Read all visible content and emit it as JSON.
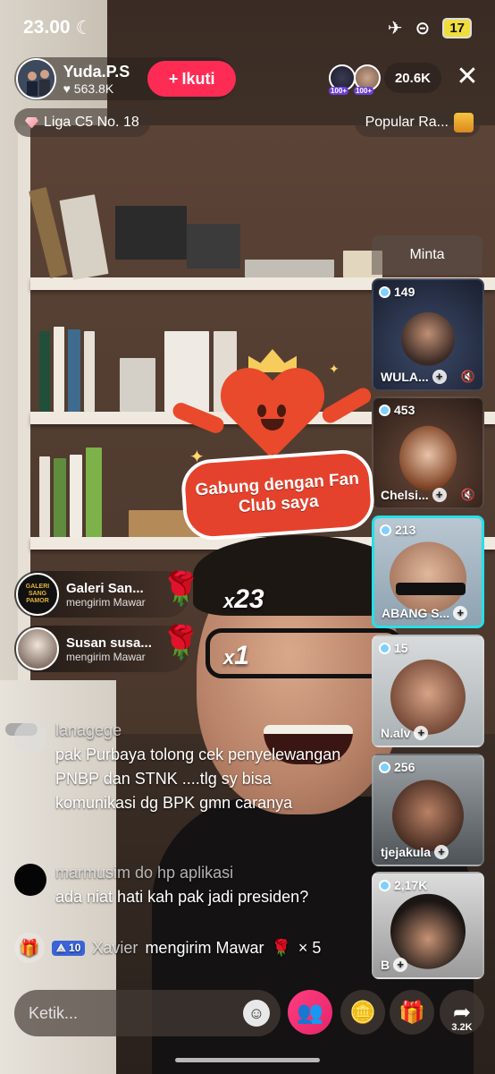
{
  "status_bar": {
    "time": "23.00",
    "battery": "17"
  },
  "host": {
    "name": "Yuda.P.S",
    "likes": "563.8K",
    "follow_label": "Ikuti"
  },
  "viewers": {
    "badge_1": "100+",
    "badge_2": "100+",
    "count": "20.6K"
  },
  "league_label": "Liga C5 No. 18",
  "popular_label": "Popular Ra...",
  "request_label": "Minta",
  "guests": [
    {
      "coins": "149",
      "name": "WULA..."
    },
    {
      "coins": "453",
      "name": "Chelsi..."
    },
    {
      "coins": "213",
      "name": "ABANG S..."
    },
    {
      "coins": "15",
      "name": "N.alv"
    },
    {
      "coins": "256",
      "name": "tjejakula"
    },
    {
      "coins": "2,17K",
      "name": "B"
    }
  ],
  "fanclub": {
    "text": "Gabung dengan Fan Club saya"
  },
  "gifts": [
    {
      "sender": "Galeri San...",
      "action": "mengirim Mawar",
      "count": "23",
      "avatar_text": "GALERI SANG PAMOR"
    },
    {
      "sender": "Susan susa...",
      "action": "mengirim Mawar",
      "count": "1"
    }
  ],
  "comments": [
    {
      "user": "lanagege",
      "text": "pak Purbaya tolong cek penyelewangan PNBP dan STNK ....tlg sy bisa komunikasi dg BPK gmn caranya"
    },
    {
      "user": "marmusim do hp aplikasi",
      "text": "ada niat hati kah pak jadi presiden?"
    }
  ],
  "system_line": {
    "level": "10",
    "user": "Xavier",
    "action": "mengirim Mawar",
    "count": "× 5"
  },
  "bottom_bar": {
    "input_placeholder": "Ketik...",
    "share_count": "3.2K"
  }
}
